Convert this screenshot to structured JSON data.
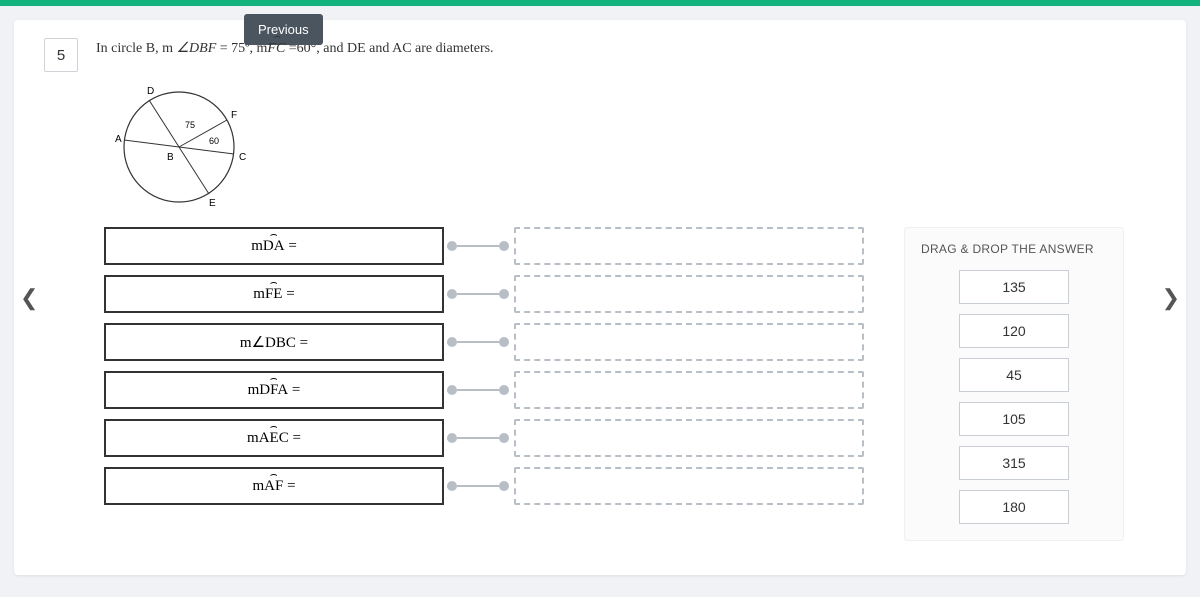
{
  "nav": {
    "previous": "Previous"
  },
  "question": {
    "number": "5",
    "text_prefix": "In  circle B, m ",
    "angle1": "∠DBF",
    "eq1": " = 75º, m",
    "arc1": "FC",
    "eq2": " =60°, and DE and AC are diameters."
  },
  "diagram": {
    "labels": {
      "A": "A",
      "B": "B",
      "C": "C",
      "D": "D",
      "E": "E",
      "F": "F"
    },
    "angles": {
      "dbf": "75",
      "fbc": "60"
    }
  },
  "rows": [
    {
      "label_pre": "m",
      "label_arc": "DA",
      "label_post": " ="
    },
    {
      "label_pre": "m",
      "label_arc": "FE",
      "label_post": " ="
    },
    {
      "label_pre": "m∠",
      "label_arc": "",
      "label_plain": "DBC",
      "label_post": " ="
    },
    {
      "label_pre": "m",
      "label_arc": "DFA",
      "label_post": " ="
    },
    {
      "label_pre": "m",
      "label_arc": "AEC",
      "label_post": " ="
    },
    {
      "label_pre": "m",
      "label_arc": "AF",
      "label_post": " ="
    }
  ],
  "panel": {
    "title": "DRAG & DROP THE ANSWER",
    "chips": [
      "135",
      "120",
      "45",
      "105",
      "315",
      "180"
    ]
  }
}
